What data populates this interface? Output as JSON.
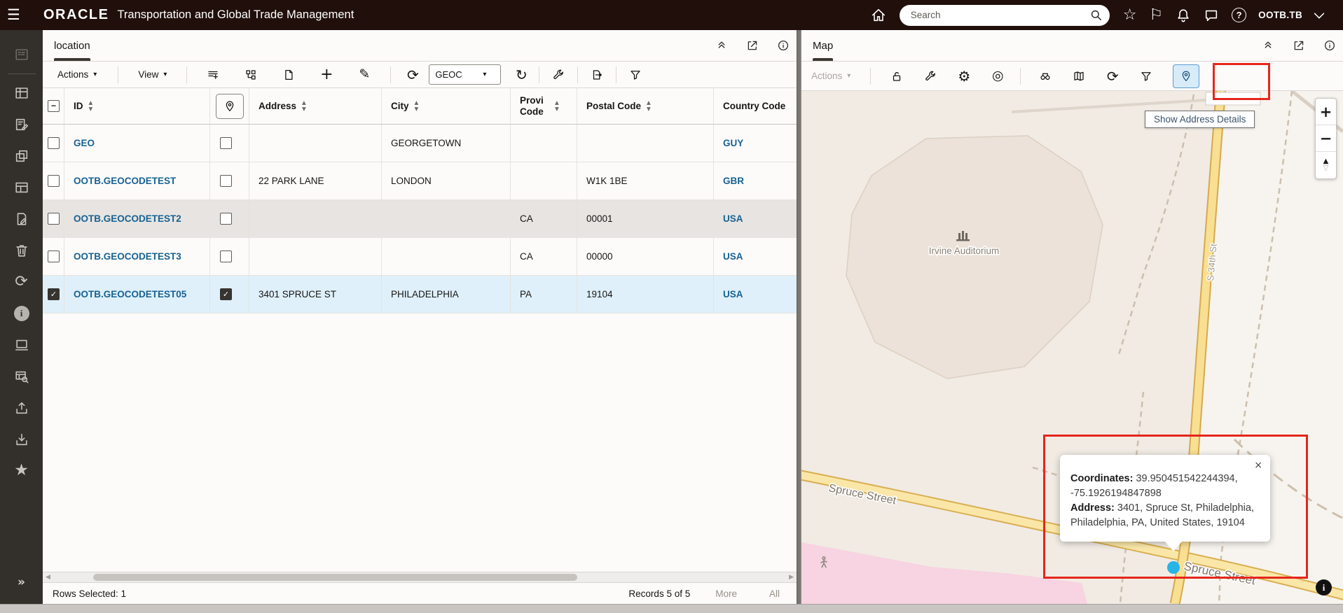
{
  "topbar": {
    "brand": "ORACLE",
    "title": "Transportation and Global Trade Management",
    "search_placeholder": "Search",
    "user": "OOTB.TB"
  },
  "sidebar": {
    "expand": "»"
  },
  "left_panel": {
    "tab": "location",
    "toolbar": {
      "actions_label": "Actions",
      "view_label": "View",
      "finder_value": "GEOC"
    },
    "table": {
      "select_all_state": "indeterminate",
      "columns": {
        "id": "ID",
        "address": "Address",
        "city": "City",
        "province": "Provi Code",
        "postal": "Postal Code",
        "country": "Country Code"
      },
      "rows": [
        {
          "id": "GEO",
          "address": "",
          "city": "GEORGETOWN",
          "province": "",
          "postal": "",
          "country": "GUY",
          "checked": false
        },
        {
          "id": "OOTB.GEOCODETEST",
          "address": "22 PARK LANE",
          "city": "LONDON",
          "province": "",
          "postal": "W1K 1BE",
          "country": "GBR",
          "checked": false
        },
        {
          "id": "OOTB.GEOCODETEST2",
          "address": "",
          "city": "",
          "province": "CA",
          "postal": "00001",
          "country": "USA",
          "checked": false
        },
        {
          "id": "OOTB.GEOCODETEST3",
          "address": "",
          "city": "",
          "province": "CA",
          "postal": "00000",
          "country": "USA",
          "checked": false
        },
        {
          "id": "OOTB.GEOCODETEST05",
          "address": "3401 SPRUCE ST",
          "city": "PHILADELPHIA",
          "province": "PA",
          "postal": "19104",
          "country": "USA",
          "checked": true
        }
      ]
    },
    "footer": {
      "rows_selected": "Rows Selected: 1",
      "records": "Records 5 of 5",
      "more": "More",
      "all": "All"
    }
  },
  "map_panel": {
    "tab": "Map",
    "toolbar": {
      "actions_label": "Actions"
    },
    "tooltip": "Show Address Details",
    "zoom_controls": {
      "zoom_in": "+",
      "zoom_out": "−",
      "pan_up": "▲",
      "pan_down": "▽"
    },
    "labels": {
      "building": "Irvine Auditorium",
      "street_spruce_left": "Spruce Street",
      "street_spruce_right": "Spruce Street",
      "street_vertical": "S 34th St"
    },
    "popup": {
      "close": "×",
      "coordinates_label": "Coordinates:",
      "coordinates_value": "39.950451542244394, -75.1926194847898",
      "address_label": "Address:",
      "address_value": "3401, Spruce St, Philadelphia, Philadelphia, PA, United States, 19104"
    },
    "attribution": "i"
  },
  "icons": {
    "hamburger": "☰",
    "star": "☆",
    "flag": "⚐",
    "help": "?",
    "gear": "⚙",
    "target": "◎",
    "refresh": "⟳",
    "redo": "↻",
    "pencil": "✎",
    "plus": "+",
    "info": "i",
    "star_filled": "★",
    "sort_up": "▲",
    "sort_down": "▼",
    "caret_down": "▾",
    "scroll_left": "◀",
    "scroll_right": "▶"
  },
  "colors": {
    "topbar_bg": "#200f0b",
    "sidebar_bg": "#332f2b",
    "accent_link": "#176293",
    "selected_row_bg": "#dff0fb",
    "current_row_bg": "#e7e4e1",
    "annotation_red": "#e5261b",
    "road_yellow": "#fae7a8",
    "map_pink": "#f8d3e1",
    "marker_blue": "#29b4e6"
  }
}
